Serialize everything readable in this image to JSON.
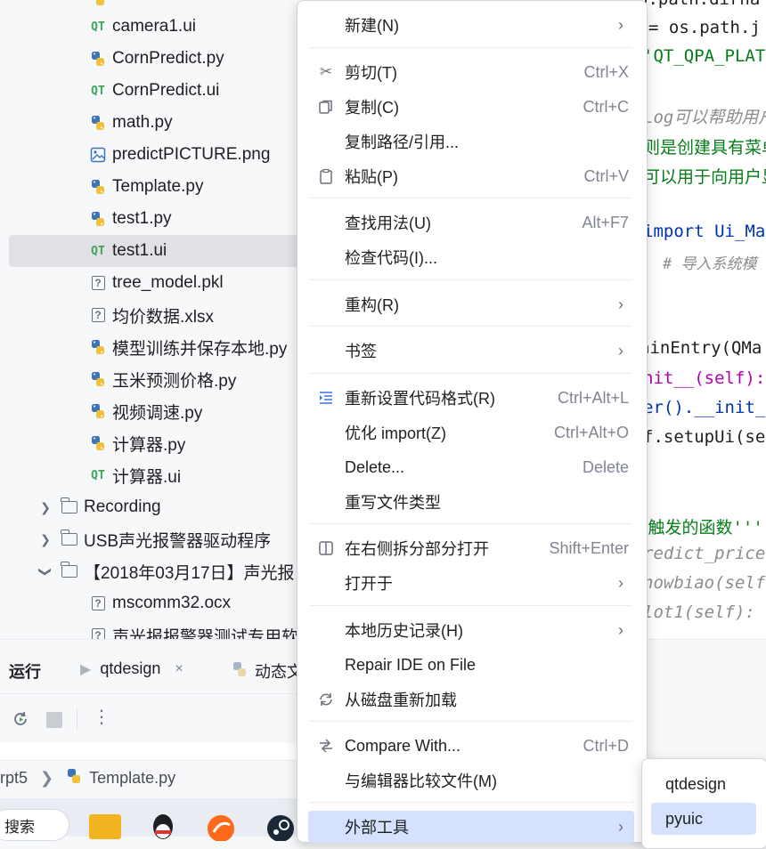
{
  "tree": {
    "items": [
      {
        "name": "camera1.ui",
        "icon": "qt-ui-icon"
      },
      {
        "name": "CornPredict.py",
        "icon": "python-icon"
      },
      {
        "name": "CornPredict.ui",
        "icon": "qt-ui-icon"
      },
      {
        "name": "math.py",
        "icon": "python-icon"
      },
      {
        "name": "predictPICTURE.png",
        "icon": "image-icon"
      },
      {
        "name": "Template.py",
        "icon": "python-icon"
      },
      {
        "name": "test1.py",
        "icon": "python-icon"
      },
      {
        "name": "test1.ui",
        "icon": "qt-ui-icon"
      },
      {
        "name": "tree_model.pkl",
        "icon": "unknown-file-icon"
      },
      {
        "name": "均价数据.xlsx",
        "icon": "unknown-file-icon"
      },
      {
        "name": "模型训练并保存本地.py",
        "icon": "python-icon"
      },
      {
        "name": "玉米预测价格.py",
        "icon": "python-icon"
      },
      {
        "name": "视频调速.py",
        "icon": "python-icon"
      },
      {
        "name": "计算器.py",
        "icon": "python-icon"
      },
      {
        "name": "计算器.ui",
        "icon": "qt-ui-icon"
      }
    ],
    "folders": [
      {
        "name": "Recording",
        "state": "collapsed"
      },
      {
        "name": "USB声光报警器驱动程序",
        "state": "collapsed"
      },
      {
        "name": "【2018年03月17日】声光报",
        "state": "expanded"
      }
    ],
    "sub_items": [
      {
        "name": "mscomm32.ocx",
        "icon": "unknown-file-icon"
      },
      {
        "name": "声光报报警器测试专用软件",
        "icon": "unknown-file-icon"
      }
    ],
    "qt_glyph": "QT",
    "unknown_glyph": "?"
  },
  "editor": {
    "lines": [
      "o.path.dirna",
      "= os.path.j",
      "'QT_QPA_PLAT",
      "Log可以帮助用户",
      "则是创建具有菜单",
      "可以用于向用户显",
      "import Ui_Ma",
      "# 导入系统模",
      "ainEntry(QMa",
      "nit__(self):",
      "er().__init_",
      "f.setupUi(se",
      "E触发的函数'''",
      "redict_price",
      "howbiao(self",
      "lot1(self):"
    ]
  },
  "bottom": {
    "run_label": "运行",
    "tabs": [
      {
        "label": "qtdesign",
        "close": "×"
      },
      {
        "label": "动态文"
      }
    ],
    "breadcrumb": [
      {
        "label": "rpt5"
      },
      {
        "label": "Template.py"
      }
    ],
    "search_label": "搜索"
  },
  "menu": {
    "items": [
      {
        "label": "新建(N)",
        "shortcut": "",
        "submenu": true,
        "icon": ""
      },
      {
        "label": "剪切(T)",
        "shortcut": "Ctrl+X",
        "submenu": false,
        "icon": "scissors-icon"
      },
      {
        "label": "复制(C)",
        "shortcut": "Ctrl+C",
        "submenu": false,
        "icon": "copy-icon"
      },
      {
        "label": "复制路径/引用...",
        "shortcut": "",
        "submenu": false,
        "icon": ""
      },
      {
        "label": "粘贴(P)",
        "shortcut": "Ctrl+V",
        "submenu": false,
        "icon": "paste-icon"
      },
      {
        "label": "查找用法(U)",
        "shortcut": "Alt+F7",
        "submenu": false,
        "icon": ""
      },
      {
        "label": "检查代码(I)...",
        "shortcut": "",
        "submenu": false,
        "icon": ""
      },
      {
        "label": "重构(R)",
        "shortcut": "",
        "submenu": true,
        "icon": ""
      },
      {
        "label": "书签",
        "shortcut": "",
        "submenu": true,
        "icon": ""
      },
      {
        "label": "重新设置代码格式(R)",
        "shortcut": "Ctrl+Alt+L",
        "submenu": false,
        "icon": "reformat-icon"
      },
      {
        "label": "优化 import(Z)",
        "shortcut": "Ctrl+Alt+O",
        "submenu": false,
        "icon": ""
      },
      {
        "label": "Delete...",
        "shortcut": "Delete",
        "submenu": false,
        "icon": ""
      },
      {
        "label": "重写文件类型",
        "shortcut": "",
        "submenu": false,
        "icon": ""
      },
      {
        "label": "在右侧拆分部分打开",
        "shortcut": "Shift+Enter",
        "submenu": false,
        "icon": "split-right-icon"
      },
      {
        "label": "打开于",
        "shortcut": "",
        "submenu": true,
        "icon": ""
      },
      {
        "label": "本地历史记录(H)",
        "shortcut": "",
        "submenu": true,
        "icon": ""
      },
      {
        "label": "Repair IDE on File",
        "shortcut": "",
        "submenu": false,
        "icon": ""
      },
      {
        "label": "从磁盘重新加载",
        "shortcut": "",
        "submenu": false,
        "icon": "reload-icon"
      },
      {
        "label": "Compare With...",
        "shortcut": "Ctrl+D",
        "submenu": false,
        "icon": "compare-icon"
      },
      {
        "label": "与编辑器比较文件(M)",
        "shortcut": "",
        "submenu": false,
        "icon": ""
      },
      {
        "label": "外部工具",
        "shortcut": "",
        "submenu": true,
        "icon": ""
      }
    ],
    "arrow": "›"
  },
  "submenu": {
    "items": [
      {
        "label": "qtdesign"
      },
      {
        "label": "pyuic"
      }
    ]
  },
  "colors": {
    "menu_highlight": "#d5e1fd",
    "tree_selection": "#dfe1e5",
    "python_blue": "#3d76b8",
    "python_yellow": "#f2c33a",
    "qt_green": "#3fa35a",
    "code_keyword": "#0033b3",
    "code_comment": "#8c8c8c",
    "code_string": "#067d17",
    "code_purple": "#871094"
  }
}
